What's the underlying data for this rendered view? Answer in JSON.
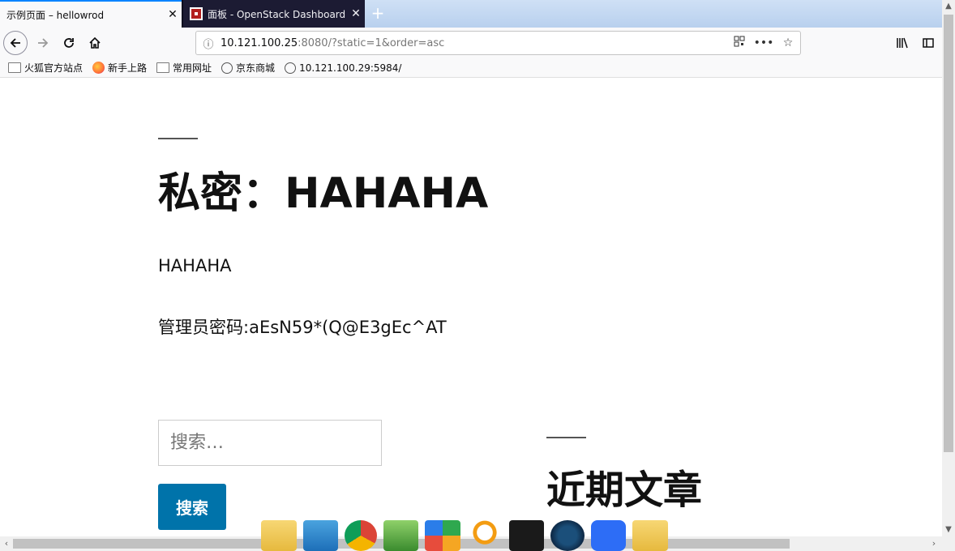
{
  "browser": {
    "tabs": [
      {
        "title": "示例页面 – hellowrod",
        "active": true
      },
      {
        "title": "面板 - OpenStack Dashboard",
        "active": false
      }
    ],
    "new_tab_symbol": "+",
    "close_symbol": "✕",
    "url": {
      "host": "10.121.100.25",
      "rest": ":8080/?static=1&order=asc"
    },
    "bookmarks": [
      {
        "label": "火狐官方站点",
        "icon": "folder-icon"
      },
      {
        "label": "新手上路",
        "icon": "firefox-icon"
      },
      {
        "label": "常用网址",
        "icon": "folder-icon"
      },
      {
        "label": "京东商城",
        "icon": "globe-icon"
      },
      {
        "label": "10.121.100.29:5984/",
        "icon": "globe-icon"
      }
    ]
  },
  "post": {
    "title": "私密：HAHAHA",
    "paragraph1": "HAHAHA",
    "paragraph2": "管理员密码:aEsN59*(Q@E3gEc^AT"
  },
  "search": {
    "placeholder": "搜索…",
    "button_label": "搜索"
  },
  "sidebar": {
    "recent_posts_title": "近期文章"
  },
  "colors": {
    "accent_tab": "#0a84ff",
    "search_button": "#0073aa",
    "inactive_tab_bg": "#1c1b33"
  },
  "taskbar": {
    "apps": [
      "folder-icon",
      "file-explorer-icon",
      "chrome-icon",
      "game-icon",
      "tiles-icon",
      "search-icon",
      "wegame-icon",
      "steam-icon",
      "f-app-icon",
      "folder-icon"
    ]
  }
}
